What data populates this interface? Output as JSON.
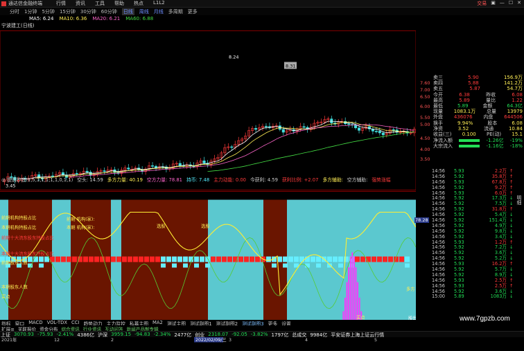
{
  "window": {
    "title": "通达信金融终端",
    "menu": [
      "行情",
      "资讯",
      "工具",
      "帮助",
      "热点",
      "L1L2"
    ],
    "right": [
      "交易",
      "▣",
      "—",
      "☐",
      "✕"
    ]
  },
  "toolbar": {
    "items": [
      "分时",
      "1分钟",
      "5分钟",
      "15分钟",
      "30分钟",
      "60分钟",
      "日线",
      "周线",
      "月线",
      "多周期",
      "更多"
    ],
    "active": "日线"
  },
  "stock": {
    "name": "宁波建工(日线)"
  },
  "ma": [
    {
      "label": "MA5: 6.24",
      "color": "#ffffff"
    },
    {
      "label": "MA10: 6.36",
      "color": "#ffee55"
    },
    {
      "label": "MA20: 6.21",
      "color": "#ff66cc"
    },
    {
      "label": "MA60: 6.88",
      "color": "#44dd44"
    }
  ],
  "price_labels": {
    "high1": "8.24",
    "high2": "8.31",
    "low": "3.45"
  },
  "axis_ticks": [
    "7.60",
    "7.00",
    "6.50",
    "6.00",
    "5.50",
    "5.00",
    "4.50",
    "4.00",
    "3.50"
  ],
  "indicator_axis": [
    "78.28"
  ],
  "quote_panel": [
    {
      "k": "卖三",
      "v": "5.90",
      "v2": "156.9万",
      "c": "r"
    },
    {
      "k": "卖四",
      "v": "5.88",
      "v2": "141.2万",
      "c": "r"
    },
    {
      "k": "卖五",
      "v": "5.87",
      "v2": "54.7万",
      "c": "r"
    },
    {
      "k": "今开",
      "v": "6.38",
      "v2": "6.08",
      "l2": "昨收",
      "c": "r"
    },
    {
      "k": "最高",
      "v": "5.89",
      "v2": "1.22",
      "l2": "量比",
      "c": "r"
    },
    {
      "k": "最低",
      "v": "5.89",
      "v2": "64.3亿",
      "l2": "金额",
      "c": "g"
    },
    {
      "k": "现量",
      "v": "1083.1万",
      "v2": "13979",
      "l2": "总量",
      "c": "y"
    },
    {
      "k": "外盘",
      "v": "436076",
      "v2": "644506",
      "l2": "内盘",
      "c": "r"
    },
    {
      "k": "换手",
      "v": "9.94%",
      "v2": "6.08",
      "l2": "股本",
      "c": "y"
    },
    {
      "k": "净资",
      "v": "3.52",
      "v2": "10.84",
      "l2": "流通",
      "c": "y"
    },
    {
      "k": "收益(三)",
      "v": "0.100",
      "v2": "15.1",
      "l2": "PE(动)",
      "c": "y"
    }
  ],
  "fund_flow": [
    {
      "k": "净流入额",
      "v": "-1.26亿",
      "pct": "-19%"
    },
    {
      "k": "大宗流入",
      "v": "-1.16亿",
      "pct": "-18%"
    }
  ],
  "ticks": [
    [
      "14:56",
      "5.93",
      "2.2万",
      "D"
    ],
    [
      "14:56",
      "5.92",
      "35.8万",
      "D"
    ],
    [
      "14:56",
      "5.93",
      "67.8万",
      "D"
    ],
    [
      "14:56",
      "5.92",
      "9.2万",
      "D"
    ],
    [
      "14:56",
      "5.93",
      "6.0万",
      "D"
    ],
    [
      "14:56",
      "5.92",
      "17.3万",
      "S"
    ],
    [
      "14:56",
      "5.92",
      "7.5万",
      "S"
    ],
    [
      "14:56",
      "5.92",
      "31.8万",
      "D"
    ],
    [
      "14:56",
      "5.92",
      "5.4万",
      "S"
    ],
    [
      "14:56",
      "5.92",
      "151.4万",
      "S"
    ],
    [
      "14:56",
      "5.92",
      "4.9万",
      "S"
    ],
    [
      "14:56",
      "5.92",
      "9.8万",
      "S"
    ],
    [
      "14:56",
      "5.92",
      "3.4万",
      "S"
    ],
    [
      "14:56",
      "5.93",
      "1.2万",
      "D"
    ],
    [
      "14:56",
      "5.92",
      "7.2万",
      "S"
    ],
    [
      "14:56",
      "5.92",
      "3.6万",
      "S"
    ],
    [
      "14:56",
      "5.92",
      "5.2万",
      "S"
    ],
    [
      "14:56",
      "5.93",
      "16.2万",
      "D"
    ],
    [
      "14:56",
      "5.92",
      "5.7万",
      "S"
    ],
    [
      "14:56",
      "5.92",
      "8.9万",
      "S"
    ],
    [
      "14:56",
      "5.93",
      "2.5万",
      "D"
    ],
    [
      "14:56",
      "5.93",
      "2.5万",
      "D"
    ],
    [
      "14:56",
      "5.92",
      "3.6万",
      "S"
    ],
    [
      "15:00",
      "5.89",
      "1083万",
      "S"
    ]
  ],
  "indicator_title": [
    {
      "t": "◎ 提前抄底(1,5,1,1,1,1,1,0,1,1)",
      "c": "#ccc"
    },
    {
      "t": "空头: 14.59",
      "c": "#ccc"
    },
    {
      "t": "多方力量: 40.19",
      "c": "#ffee55"
    },
    {
      "t": "空方力量: 78.81",
      "c": "#ff66cc"
    },
    {
      "t": "持币: 7.48",
      "c": "#5ef"
    },
    {
      "t": "主力动能: 0.00",
      "c": "#ff3b3b"
    },
    {
      "t": "今获利: 4.59",
      "c": "#ccc"
    },
    {
      "t": "获利比例: +2.07",
      "c": "#ff3b3b"
    },
    {
      "t": "多方辅助: ",
      "c": "#ffee55"
    },
    {
      "t": "空方辅助: ",
      "c": "#ccc"
    },
    {
      "t": "强势涨幅",
      "c": "#ff3b3b"
    }
  ],
  "indicator_labels": [
    {
      "t": "前期机构持股占比",
      "c": "#ffee55"
    },
    {
      "t": "本期机构持股占比",
      "c": "#ffee55"
    },
    {
      "t": "前期十大流东股东持股占比",
      "c": "#ff3b3b"
    },
    {
      "t": "本期十大流东股东持股占比",
      "c": "#ff3b3b"
    },
    {
      "t": "前期股东人数",
      "c": "#ffee55"
    },
    {
      "t": "本期股东人数",
      "c": "#ffee55"
    },
    {
      "t": "买点",
      "c": "#ffee55"
    }
  ],
  "indicator_marks": {
    "a": "本期 机构(家):",
    "b": "前期 机构(家):",
    "sel1": "选股",
    "sel2": "选股",
    "buy": "买点",
    "duo": "多方",
    "sell": "股出"
  },
  "date_label": "2022/02/09/三",
  "month_axis": [
    "2021年",
    "12",
    "2",
    "3",
    "4",
    "5"
  ],
  "bottom_tabs": [
    "指标",
    "窗口",
    "MACD",
    "VOL-TDX",
    "CCI",
    "趋势动力",
    "主力监控",
    "私募主图",
    "MA2",
    "测试主图",
    "测试副图1",
    "测试副图2",
    "测试副图3",
    "更多",
    "设置"
  ],
  "bottom_tabs_active": "测试副图3",
  "sub_tabs": [
    "扩展≡",
    "关联报价",
    "资金分布",
    "综合资讯",
    "行业资讯",
    "互动问答",
    "新闻产品制专辑"
  ],
  "status": [
    {
      "t": "上证",
      "c": "w"
    },
    {
      "t": "3070.93",
      "c": "g"
    },
    {
      "t": "-75.93",
      "c": "g"
    },
    {
      "t": "-2.41%",
      "c": "g"
    },
    {
      "t": "4386亿",
      "c": "w"
    },
    {
      "t": "沪深",
      "c": "w"
    },
    {
      "t": "3959.15",
      "c": "g"
    },
    {
      "t": "-94.83",
      "c": "g"
    },
    {
      "t": "-2.34%",
      "c": "g"
    },
    {
      "t": "2477亿",
      "c": "w"
    },
    {
      "t": "创业",
      "c": "w"
    },
    {
      "t": "2318.07",
      "c": "g"
    },
    {
      "t": "-92.05",
      "c": "g"
    },
    {
      "t": "-3.82%",
      "c": "g"
    },
    {
      "t": "1797亿",
      "c": "w"
    },
    {
      "t": "总成交",
      "c": "w"
    },
    {
      "t": "9984亿",
      "c": "w"
    },
    {
      "t": "平安证券上海上证云行情",
      "c": "w"
    }
  ],
  "watermark": "www.7gpzb.com",
  "right_label": "明细",
  "fenshi": "分时"
}
